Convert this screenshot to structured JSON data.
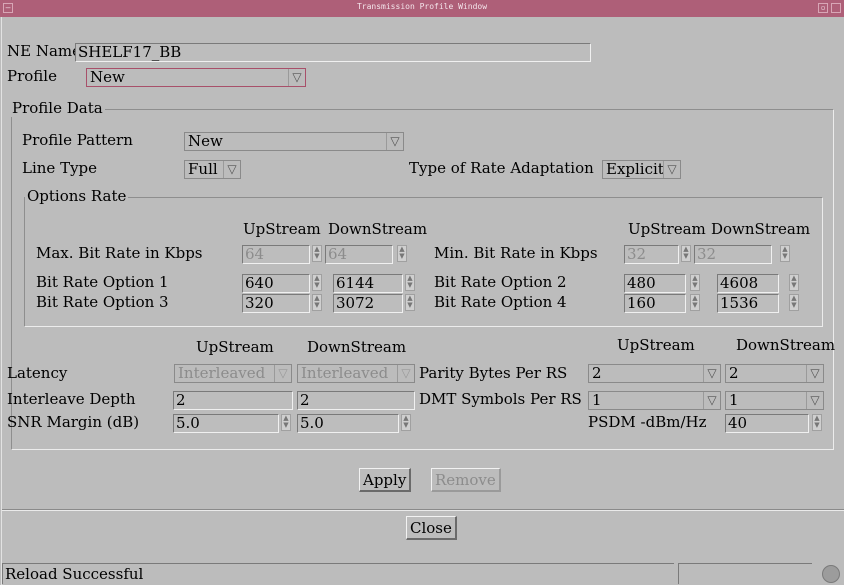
{
  "window": {
    "title": "Transmission Profile Window",
    "min_glyph": "—",
    "close_glyph": "▫"
  },
  "ne_name": {
    "label": "NE Name",
    "value": "SHELF17_BB"
  },
  "profile": {
    "label": "Profile",
    "value": "New"
  },
  "profile_data": {
    "title": "Profile Data",
    "pattern": {
      "label": "Profile Pattern",
      "value": "New"
    },
    "line_type": {
      "label": "Line Type",
      "value": "Full"
    },
    "rate_adaptation": {
      "label": "Type of Rate Adaptation",
      "value": "Explicit"
    },
    "options_rate": {
      "title": "Options Rate",
      "col_up": "UpStream",
      "col_down": "DownStream",
      "max_bit_rate": {
        "label": "Max. Bit Rate in Kbps",
        "up": "64",
        "down": "64"
      },
      "min_bit_rate": {
        "label": "Min. Bit Rate in Kbps",
        "up": "32",
        "down": "32"
      },
      "option1": {
        "label": "Bit Rate Option 1",
        "up": "640",
        "down": "6144"
      },
      "option2": {
        "label": "Bit Rate Option 2",
        "up": "480",
        "down": "4608"
      },
      "option3": {
        "label": "Bit Rate Option 3",
        "up": "320",
        "down": "3072"
      },
      "option4": {
        "label": "Bit Rate Option 4",
        "up": "160",
        "down": "1536"
      }
    },
    "col_up": "UpStream",
    "col_down": "DownStream",
    "latency": {
      "label": "Latency",
      "up": "Interleaved",
      "down": "Interleaved"
    },
    "interleave_depth": {
      "label": "Interleave Depth",
      "up": "2",
      "down": "2"
    },
    "snr_margin": {
      "label": "SNR Margin (dB)",
      "up": "5.0",
      "down": "5.0"
    },
    "parity_bytes": {
      "label": "Parity Bytes Per RS",
      "up": "2",
      "down": "2"
    },
    "dmt_symbols": {
      "label": "DMT Symbols Per RS",
      "up": "1",
      "down": "1"
    },
    "psdm": {
      "label": "PSDM -dBm/Hz",
      "value": "40"
    }
  },
  "buttons": {
    "apply": "Apply",
    "remove": "Remove",
    "close": "Close"
  },
  "status": {
    "text": "Reload Successful"
  },
  "icons": {
    "dropdown": "dropdown-arrow-icon",
    "spin": "spin-arrows-icon",
    "status": "status-indicator-icon"
  }
}
